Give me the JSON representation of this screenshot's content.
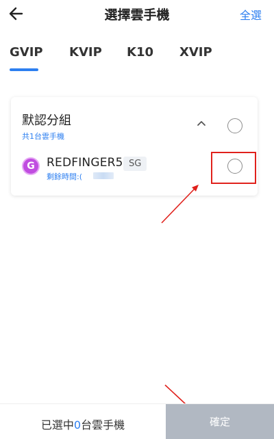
{
  "header": {
    "title": "選擇雲手機",
    "select_all_label": "全選"
  },
  "tabs": [
    {
      "label": "GVIP",
      "selected": true
    },
    {
      "label": "KVIP",
      "selected": false
    },
    {
      "label": "K10",
      "selected": false
    },
    {
      "label": "XVIP",
      "selected": false
    }
  ],
  "group": {
    "title": "默認分組",
    "count_text": "共1台雲手機",
    "expanded": true,
    "selected": false,
    "devices": [
      {
        "avatar_letter": "G",
        "name": "REDFINGER5",
        "region": "SG",
        "remaining_label": "剩餘時間:(",
        "selected": false
      }
    ]
  },
  "footer": {
    "selected_prefix": "已選中",
    "selected_count": "0",
    "selected_suffix": "台雲手機",
    "confirm_label": "確定"
  },
  "colors": {
    "accent": "#2d7ff0",
    "annotation_red": "#e0201b",
    "confirm_disabled": "#b1b8c2",
    "avatar": "#c04de0"
  },
  "icons": {
    "back": "arrow-left-icon",
    "collapse": "chevron-up-icon"
  }
}
